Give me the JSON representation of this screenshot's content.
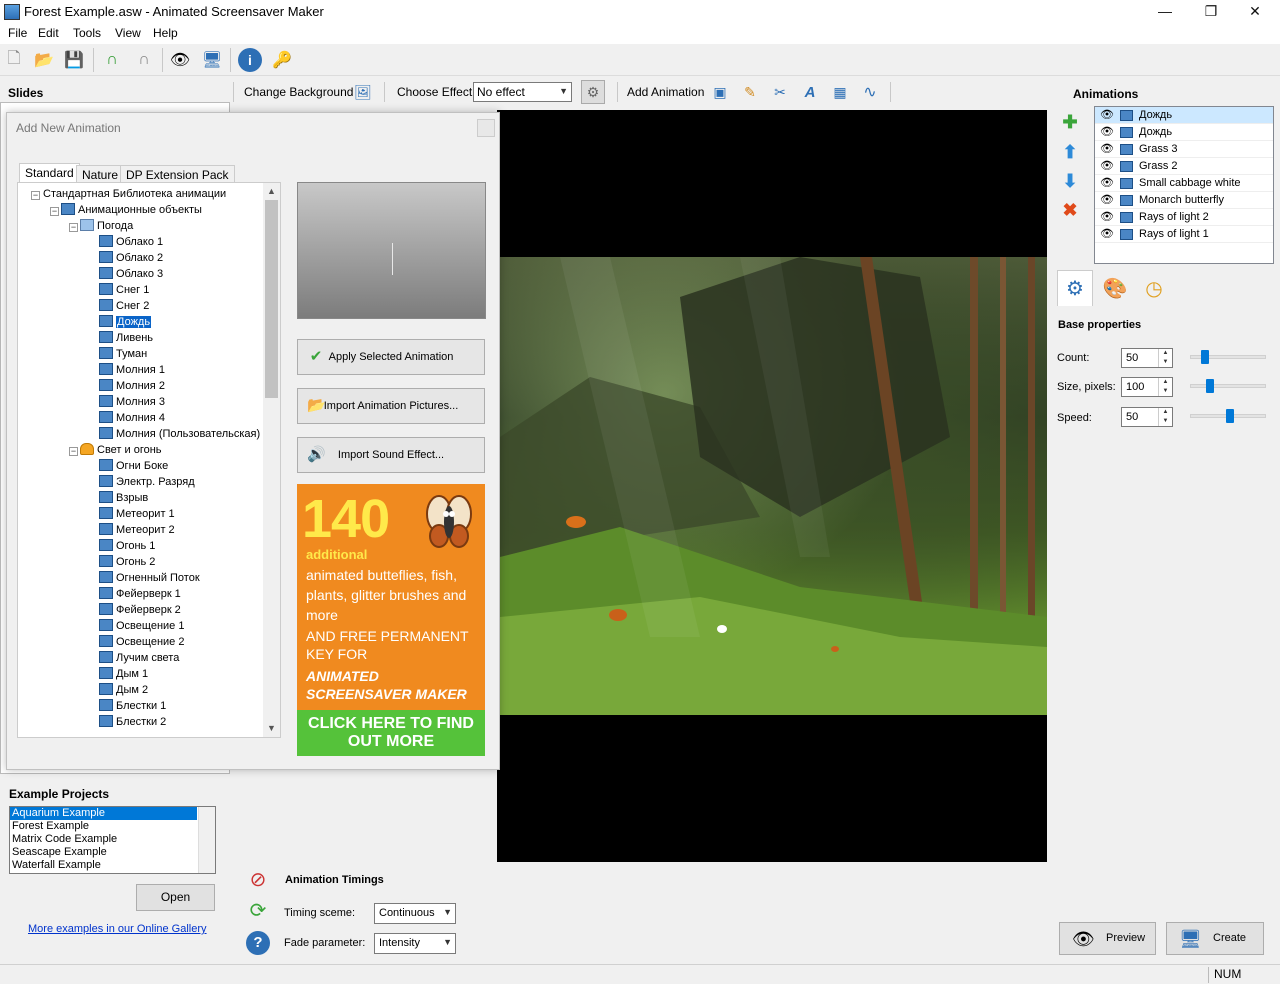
{
  "window": {
    "title": "Forest Example.asw - Animated Screensaver Maker",
    "minimize": "—",
    "maximize": "❐",
    "close": "✕"
  },
  "menu": [
    "File",
    "Edit",
    "Tools",
    "View",
    "Help"
  ],
  "slides": {
    "title": "Slides"
  },
  "examples": {
    "title": "Example Projects",
    "items": [
      "Aquarium Example",
      "Forest Example",
      "Matrix Code Example",
      "Seascape Example",
      "Waterfall Example"
    ],
    "selected_index": 0,
    "open_label": "Open",
    "gallery_link": "More examples in our Online Gallery"
  },
  "toolbar2": {
    "change_background": "Change Background",
    "choose_effect": "Choose Effect:",
    "effect_value": "No effect",
    "add_animation": "Add Animation"
  },
  "dialog": {
    "title": "Add New Animation",
    "tabs": [
      "Standard",
      "Nature",
      "DP Extension Pack"
    ],
    "active_tab": 0,
    "tree": {
      "root": "Стандартная Библиотека анимации",
      "group": "Анимационные объекты",
      "weather_folder": "Погода",
      "weather_items": [
        "Облако 1",
        "Облако 2",
        "Облако 3",
        "Снег 1",
        "Снег 2",
        "Дождь",
        "Ливень",
        "Туман",
        "Молния 1",
        "Молния 2",
        "Молния 3",
        "Молния 4",
        "Молния (Пользовательская)"
      ],
      "selected_item": "Дождь",
      "light_folder": "Свет и огонь",
      "light_items": [
        "Огни Боке",
        "Электр. Разряд",
        "Взрыв",
        "Метеорит 1",
        "Метеорит 2",
        "Огонь 1",
        "Огонь 2",
        "Огненный Поток",
        "Фейерверк 1",
        "Фейерверк 2",
        "Освещение 1",
        "Освещение 2",
        "Лучим света",
        "Дым 1",
        "Дым 2",
        "Блестки 1",
        "Блестки 2"
      ]
    },
    "apply_label": "Apply Selected Animation",
    "import_pictures_label": "Import Animation Pictures...",
    "import_sound_label": "Import Sound Effect...",
    "promo": {
      "number": "140",
      "additional": "additional",
      "line1": "animated butteflies, fish, plants, glitter brushes and more",
      "line2": "AND FREE PERMANENT KEY FOR",
      "line3": "ANIMATED SCREENSAVER MAKER",
      "cta": "CLICK HERE TO FIND OUT MORE"
    }
  },
  "animations": {
    "title": "Animations",
    "items": [
      "Дождь",
      "Дождь",
      "Grass 3",
      "Grass 2",
      "Small cabbage white",
      "Monarch butterfly",
      "Rays of light 2",
      "Rays of light 1"
    ],
    "selected_index": 0
  },
  "properties": {
    "title": "Base properties",
    "count_label": "Count:",
    "count_value": "50",
    "count_level": 0.15,
    "size_label": "Size, pixels:",
    "size_value": "100",
    "size_level": 0.22,
    "speed_label": "Speed:",
    "speed_value": "50",
    "speed_level": 0.52
  },
  "timings": {
    "title": "Animation Timings",
    "timing_label": "Timing sceme:",
    "timing_value": "Continuous",
    "fade_label": "Fade parameter:",
    "fade_value": "Intensity"
  },
  "actions": {
    "preview": "Preview",
    "create": "Create"
  },
  "status": {
    "num": "NUM"
  },
  "colors": {
    "accent": "#0078d7",
    "promo_orange": "#f08a1f",
    "promo_green": "#55c23a",
    "promo_yellow": "#ffe94a"
  }
}
